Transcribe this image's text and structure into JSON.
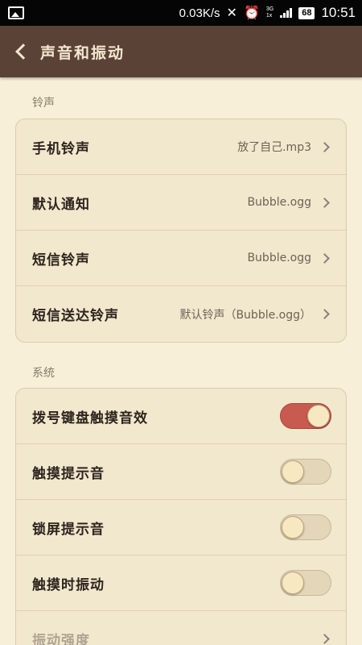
{
  "statusbar": {
    "speed": "0.03K/s",
    "net": "3G",
    "net_sub": "1x",
    "battery": "68",
    "time": "10:51"
  },
  "header": {
    "title": "声音和振动"
  },
  "sections": {
    "ringtone": {
      "label": "铃声",
      "items": [
        {
          "label": "手机铃声",
          "value": "放了自己.mp3"
        },
        {
          "label": "默认通知",
          "value": "Bubble.ogg"
        },
        {
          "label": "短信铃声",
          "value": "Bubble.ogg"
        },
        {
          "label": "短信送达铃声",
          "value": "默认铃声（Bubble.ogg）"
        }
      ]
    },
    "system": {
      "label": "系统",
      "items": [
        {
          "label": "拨号键盘触摸音效",
          "on": true
        },
        {
          "label": "触摸提示音",
          "on": false
        },
        {
          "label": "锁屏提示音",
          "on": false
        },
        {
          "label": "触摸时振动",
          "on": false
        },
        {
          "label": "振动强度"
        }
      ]
    }
  },
  "colors": {
    "header": "#5a4336",
    "background": "#f7efd8",
    "toggle_on": "#c85a50"
  }
}
